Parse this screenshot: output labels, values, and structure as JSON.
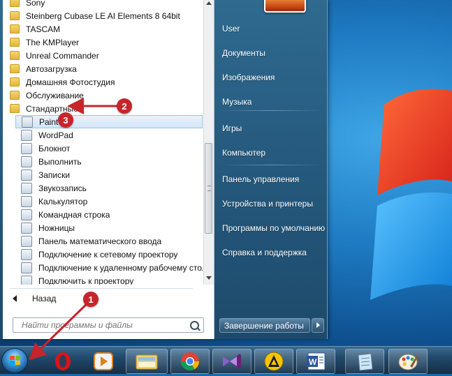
{
  "start_menu": {
    "programs": [
      {
        "label": "Sony",
        "icon": "folder-icon"
      },
      {
        "label": "Steinberg Cubase LE AI Elements 8 64bit",
        "icon": "folder-icon"
      },
      {
        "label": "TASCAM",
        "icon": "folder-icon"
      },
      {
        "label": "The KMPlayer",
        "icon": "folder-icon"
      },
      {
        "label": "Unreal Commander",
        "icon": "folder-icon"
      },
      {
        "label": "Автозагрузка",
        "icon": "folder-icon"
      },
      {
        "label": "Домашняя Фотостудия",
        "icon": "folder-icon"
      },
      {
        "label": "Обслуживание",
        "icon": "folder-icon"
      },
      {
        "label": "Стандартные",
        "icon": "folder-icon"
      },
      {
        "label": "Paint",
        "icon": "paint-icon"
      },
      {
        "label": "WordPad",
        "icon": "wordpad-icon"
      },
      {
        "label": "Блокнот",
        "icon": "notepad-icon"
      },
      {
        "label": "Выполнить",
        "icon": "run-icon"
      },
      {
        "label": "Записки",
        "icon": "sticky-notes-icon"
      },
      {
        "label": "Звукозапись",
        "icon": "microphone-icon"
      },
      {
        "label": "Калькулятор",
        "icon": "calculator-icon"
      },
      {
        "label": "Командная строка",
        "icon": "command-prompt-icon"
      },
      {
        "label": "Ножницы",
        "icon": "scissors-icon"
      },
      {
        "label": "Панель математического ввода",
        "icon": "math-input-icon"
      },
      {
        "label": "Подключение к сетевому проектору",
        "icon": "network-projector-icon"
      },
      {
        "label": "Подключение к удаленному рабочему стол",
        "icon": "remote-desktop-icon"
      },
      {
        "label": "Подключить к проектору",
        "icon": "projector-icon"
      }
    ],
    "selected_index": 9,
    "back_label": "Назад",
    "search_placeholder": "Найти программы и файлы",
    "right_items": [
      {
        "label": "User"
      },
      {
        "label": "Документы"
      },
      {
        "label": "Изображения"
      },
      {
        "label": "Музыка"
      },
      {
        "label": "Игры"
      },
      {
        "label": "Компьютер"
      },
      {
        "label": "Панель управления"
      },
      {
        "label": "Устройства и принтеры"
      },
      {
        "label": "Программы по умолчанию"
      },
      {
        "label": "Справка и поддержка"
      }
    ],
    "shutdown_label": "Завершение работы"
  },
  "taskbar": {
    "items": [
      {
        "name": "start-orb-icon"
      },
      {
        "name": "opera-icon"
      },
      {
        "name": "media-player-icon"
      },
      {
        "name": "file-explorer-icon"
      },
      {
        "name": "chrome-icon"
      },
      {
        "name": "visual-studio-icon"
      },
      {
        "name": "aimp-icon"
      },
      {
        "name": "word-icon"
      },
      {
        "name": "notepad-taskbar-icon"
      },
      {
        "name": "paint-taskbar-icon"
      }
    ]
  },
  "annotations": {
    "badge_1": "1",
    "badge_2": "2",
    "badge_3": "3",
    "color": "#c8242c"
  },
  "colors": {
    "menu_right": "#25597d",
    "taskbar": "#21496b",
    "selection": "#d4e6f8"
  }
}
